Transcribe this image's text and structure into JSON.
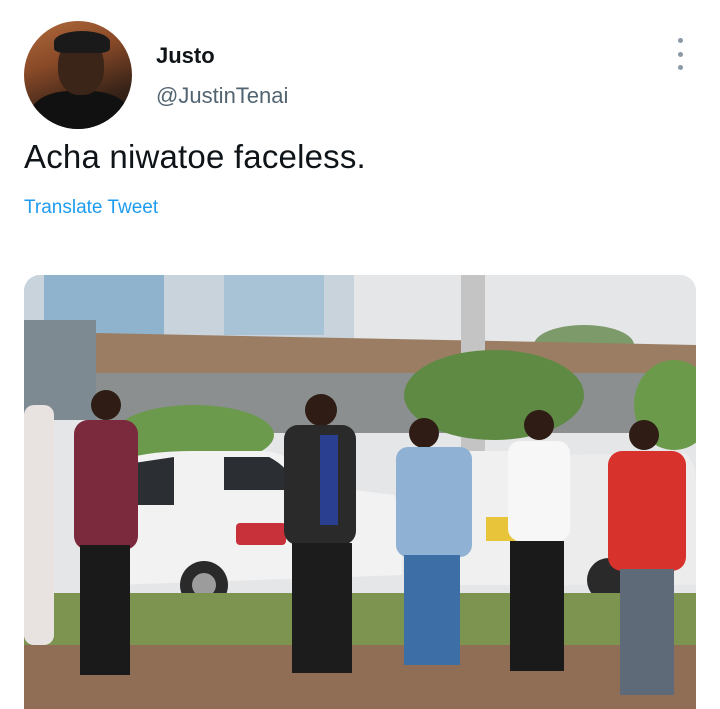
{
  "author": {
    "display_name": "Justo",
    "handle": "@JustinTenai"
  },
  "tweet": {
    "text": "Acha niwatoe faceless.",
    "translate_label": "Translate Tweet"
  },
  "colors": {
    "link": "#1d9bf0",
    "secondary_text": "#536471",
    "primary_text": "#0f1419"
  },
  "icons": {
    "more": "more-vertical-icon"
  }
}
